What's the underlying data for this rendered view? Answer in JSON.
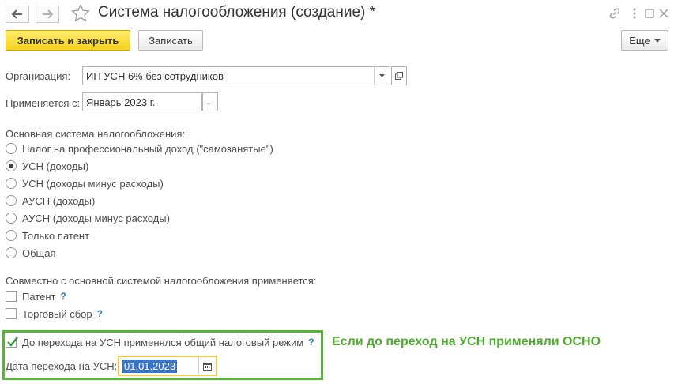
{
  "header": {
    "title": "Система налогообложения (создание) *",
    "back_icon": "arrow-left-icon",
    "forward_icon": "arrow-right-icon",
    "favorite_icon": "star-icon",
    "link_icon": "link-icon",
    "menu_icon": "more-vertical-icon",
    "maximize_icon": "maximize-icon",
    "close_icon": "close-icon"
  },
  "toolbar": {
    "save_close_label": "Записать и закрыть",
    "save_label": "Записать",
    "more_label": "Еще"
  },
  "form": {
    "organization_label": "Организация:",
    "organization_value": "ИП УСН 6% без сотрудников",
    "applies_from_label": "Применяется с:",
    "applies_from_value": "Январь 2023 г.",
    "applies_from_btn": "...",
    "main_system_label": "Основная система налогообложения:",
    "main_systems": [
      {
        "label": "Налог на профессиональный доход (\"самозанятые\")",
        "selected": false
      },
      {
        "label": "УСН (доходы)",
        "selected": true
      },
      {
        "label": "УСН (доходы минус расходы)",
        "selected": false
      },
      {
        "label": "АУСН (доходы)",
        "selected": false
      },
      {
        "label": "АУСН (доходы минус расходы)",
        "selected": false
      },
      {
        "label": "Только патент",
        "selected": false
      },
      {
        "label": "Общая",
        "selected": false
      }
    ],
    "combined_label": "Совместно с основной системой налогообложения применяется:",
    "patent_label": "Патент",
    "trade_fee_label": "Торговый сбор",
    "help_mark": "?",
    "prior_general_label": "До перехода на УСН применялся общий налоговый режим",
    "transition_date_label": "Дата перехода на УСН:",
    "transition_date_value": "01.01.2023"
  },
  "annotation": {
    "text": "Если до переход на УСН применяли ОСНО",
    "color": "#4caa2c"
  },
  "colors": {
    "primary_button": "#f7d21c",
    "selection": "#3874c8",
    "highlight_border": "#57b33a",
    "focus_border": "#f2c94c"
  }
}
